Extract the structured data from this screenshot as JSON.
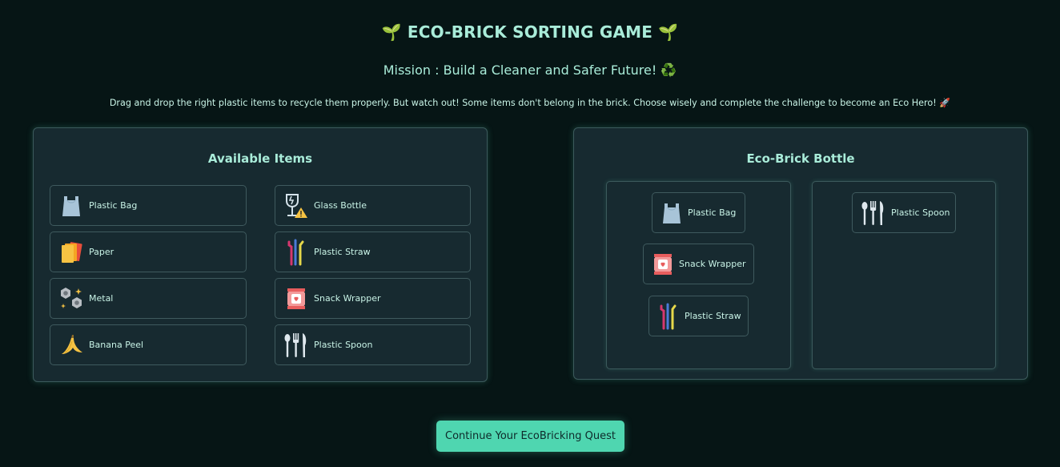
{
  "header": {
    "title": "🌱 ECO-BRICK SORTING GAME 🌱",
    "subtitle": "Mission : Build a Cleaner and Safer Future! ♻️",
    "instructions": "Drag and drop the right plastic items to recycle them properly. But watch out! Some items don't belong in the brick. Choose wisely and complete the challenge to become an Eco Hero! 🚀"
  },
  "available": {
    "title": "Available Items",
    "items": [
      {
        "label": "Plastic Bag",
        "icon": "plastic-bag-icon"
      },
      {
        "label": "Glass Bottle",
        "icon": "glass-bottle-icon"
      },
      {
        "label": "Paper",
        "icon": "paper-icon"
      },
      {
        "label": "Plastic Straw",
        "icon": "straw-icon"
      },
      {
        "label": "Metal",
        "icon": "metal-nuts-icon"
      },
      {
        "label": "Snack Wrapper",
        "icon": "snack-wrapper-icon"
      },
      {
        "label": "Banana Peel",
        "icon": "banana-icon"
      },
      {
        "label": "Plastic Spoon",
        "icon": "cutlery-icon"
      }
    ]
  },
  "ecobrick": {
    "title": "Eco-Brick Bottle",
    "bin_a": [
      {
        "label": "Plastic Bag",
        "icon": "plastic-bag-icon"
      },
      {
        "label": "Snack Wrapper",
        "icon": "snack-wrapper-icon"
      },
      {
        "label": "Plastic Straw",
        "icon": "straw-icon"
      }
    ],
    "bin_b": [
      {
        "label": "Plastic Spoon",
        "icon": "cutlery-icon"
      }
    ]
  },
  "actions": {
    "continue_label": "Continue Your EcoBricking Quest"
  },
  "colors": {
    "background": "#061515",
    "panel": "#172a30",
    "accent": "#4fd6b0",
    "text": "#a9ecd9"
  }
}
